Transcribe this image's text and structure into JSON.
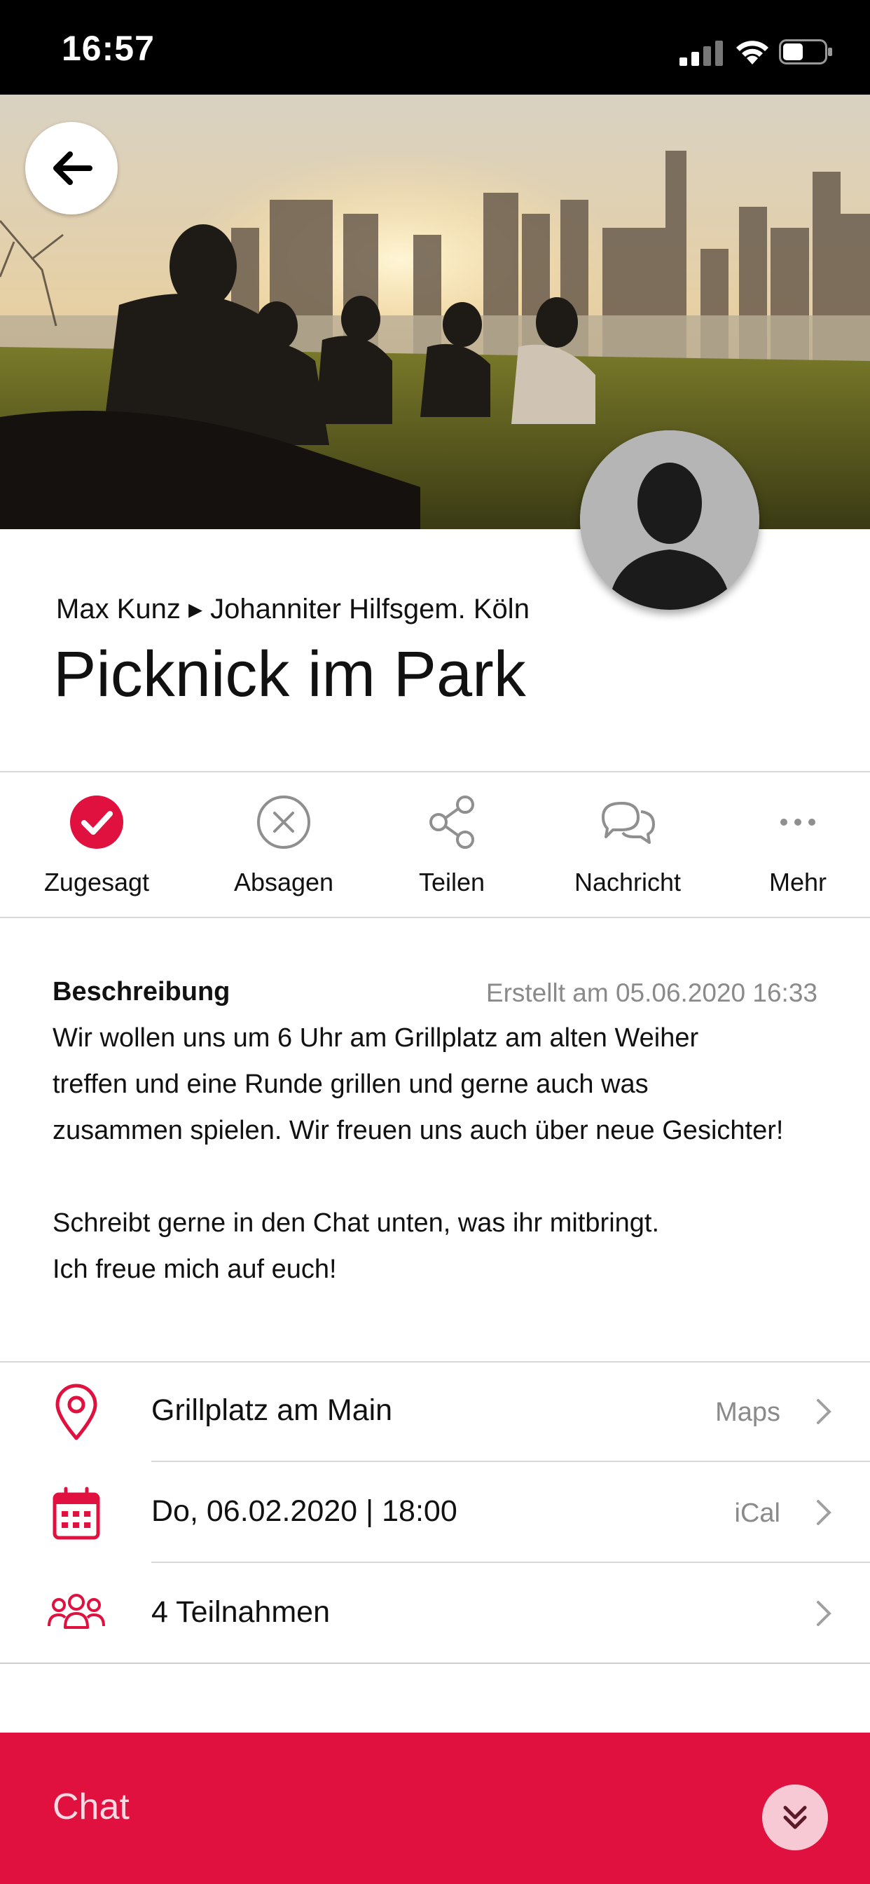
{
  "status_bar": {
    "time": "16:57"
  },
  "event": {
    "breadcrumb": "Max Kunz ▸ Johanniter Hilfsgem. Köln",
    "title": "Picknick im Park"
  },
  "actions": [
    {
      "label": "Zugesagt",
      "icon": "check-circle-icon"
    },
    {
      "label": "Absagen",
      "icon": "x-circle-icon"
    },
    {
      "label": "Teilen",
      "icon": "share-icon"
    },
    {
      "label": "Nachricht",
      "icon": "chat-bubbles-icon"
    },
    {
      "label": "Mehr",
      "icon": "more-dots-icon"
    }
  ],
  "description": {
    "heading": "Beschreibung",
    "created": "Erstellt am 05.06.2020 16:33",
    "lines": [
      "Wir wollen uns um 6 Uhr am Grillplatz am alten Weiher",
      "treffen und eine Runde grillen und gerne auch was",
      "zusammen spielen. Wir freuen uns auch über neue Gesichter!",
      "",
      "Schreibt gerne in den Chat unten, was ihr mitbringt.",
      "Ich freue mich auf euch!"
    ]
  },
  "info": [
    {
      "icon": "location-pin-icon",
      "text": "Grillplatz am Main",
      "meta": "Maps"
    },
    {
      "icon": "calendar-icon",
      "text": "Do, 06.02.2020 | 18:00",
      "meta": "iCal"
    },
    {
      "icon": "participants-icon",
      "text": "4 Teilnahmen",
      "meta": ""
    }
  ],
  "chat": {
    "label": "Chat"
  },
  "colors": {
    "accent": "#e0103f",
    "muted": "#8a8a8a",
    "divider": "#d8d8d8"
  }
}
